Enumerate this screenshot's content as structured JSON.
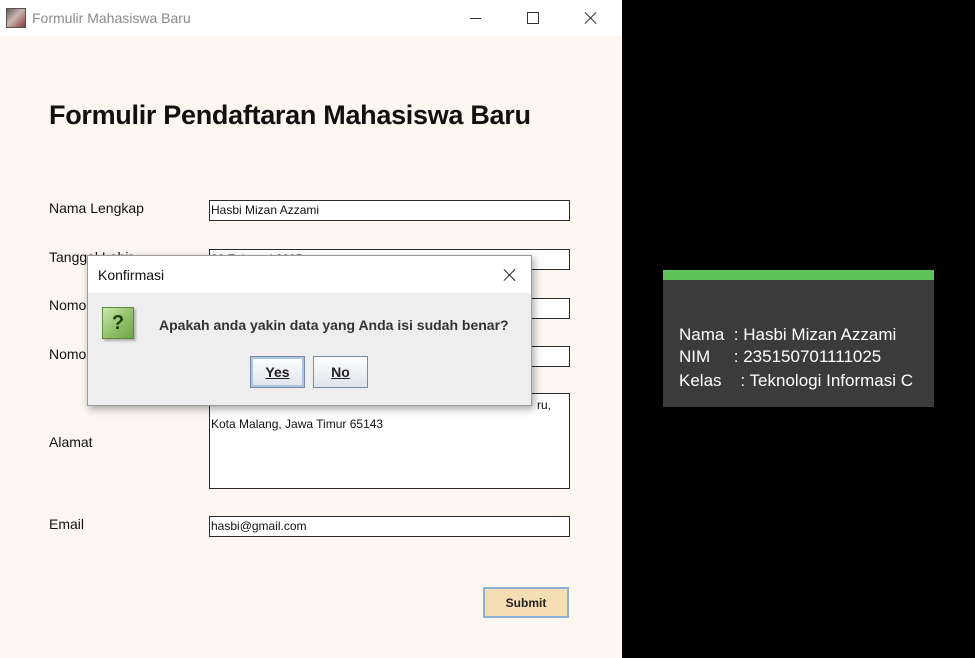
{
  "window": {
    "title": "Formulir Mahasiswa Baru"
  },
  "form": {
    "title": "Formulir Pendaftaran Mahasiswa Baru",
    "fields": {
      "nama": {
        "label": "Nama Lengkap",
        "value": "Hasbi Mizan Azzami"
      },
      "tanggal": {
        "label": "Tanggal Lahir",
        "value": "20 Februari 2005"
      },
      "nomor1": {
        "label": "Nomo",
        "value": ""
      },
      "nomor2": {
        "label": "Nomo",
        "value": ""
      },
      "alamat": {
        "label": "Alamat",
        "line1": "ru,",
        "line2": "Kota Malang, Jawa Timur 65143"
      },
      "email": {
        "label": "Email",
        "value": "hasbi@gmail.com"
      }
    },
    "submit_label": "Submit"
  },
  "dialog": {
    "title": "Konfirmasi",
    "message": "Apakah anda yakin data yang Anda isi sudah benar?",
    "icon": "?",
    "yes_label": "Yes",
    "no_label": "No"
  },
  "info_panel": {
    "accent_color": "#5ec45a",
    "nama_line": "Nama  : Hasbi Mizan Azzami",
    "nim_line": "NIM     : 235150701111025",
    "kelas_line": "Kelas    : Teknologi Informasi C"
  }
}
